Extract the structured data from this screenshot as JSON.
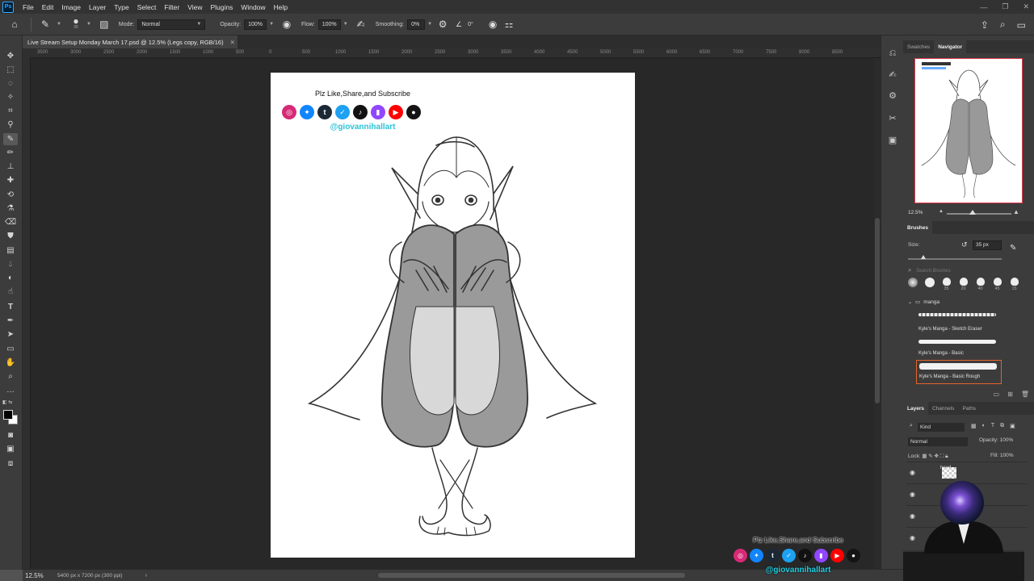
{
  "app": {
    "logo": "Ps"
  },
  "menu": [
    "File",
    "Edit",
    "Image",
    "Layer",
    "Type",
    "Select",
    "Filter",
    "View",
    "Plugins",
    "Window",
    "Help"
  ],
  "options": {
    "brush_size": "35",
    "mode_label": "Mode:",
    "mode_value": "Normal",
    "opacity_label": "Opacity:",
    "opacity_value": "100%",
    "flow_label": "Flow:",
    "flow_value": "100%",
    "smoothing_label": "Smoothing:",
    "smoothing_value": "0%",
    "angle_value": "0°"
  },
  "document": {
    "tab_title": "Live Stream Setup Monday March 17.psd @ 12.5% (Legs copy, RGB/16)",
    "zoom": "12.5%",
    "info": "5400 px x 7200 px (300 ppi)"
  },
  "ruler_ticks": [
    "3500",
    "3000",
    "2500",
    "2000",
    "1500",
    "1000",
    "500",
    "0",
    "500",
    "1000",
    "1500",
    "2000",
    "2500",
    "3000",
    "3500",
    "4000",
    "4500",
    "5000",
    "5500",
    "6000",
    "6500",
    "7000",
    "7500",
    "8000",
    "8500"
  ],
  "artwork": {
    "promo_text": "Plz Like,Share,and Subscribe",
    "handle": "@giovannihallart",
    "socials": [
      {
        "icon": "instagram-icon",
        "glyph": "◎",
        "color": "#d62976"
      },
      {
        "icon": "bluesky-icon",
        "glyph": "✦",
        "color": "#1185fe"
      },
      {
        "icon": "tumblr-icon",
        "glyph": "t",
        "color": "#1b2836"
      },
      {
        "icon": "twitter-icon",
        "glyph": "✓",
        "color": "#1da1f2"
      },
      {
        "icon": "tiktok-icon",
        "glyph": "♪",
        "color": "#111111"
      },
      {
        "icon": "twitch-icon",
        "glyph": "▮",
        "color": "#9146ff"
      },
      {
        "icon": "youtube-icon",
        "glyph": "▶",
        "color": "#ff0000"
      },
      {
        "icon": "patreon-icon",
        "glyph": "●",
        "color": "#141414"
      }
    ]
  },
  "panels": {
    "top_tabs": [
      "Swatches",
      "Navigator"
    ],
    "nav_zoom": "12.5%",
    "brushes_title": "Brushes",
    "size_label": "Size:",
    "size_value": "35 px",
    "search_placeholder": "Search Brushes",
    "tip_sizes": [
      "",
      "",
      "35",
      "20",
      "40",
      "45",
      "15"
    ],
    "folder": "manga",
    "brushes": [
      "Kyle's Manga - Sketch Eraser",
      "Kyle's Manga - Basic",
      "Kyle's Manga - Basic Rough"
    ],
    "layer_tabs": [
      "Layers",
      "Channels",
      "Paths"
    ],
    "kind": "Kind",
    "blend": "Normal",
    "opacity_label": "Opacity:",
    "opacity_value": "100%",
    "lock_label": "Lock:",
    "fill_label": "Fill:",
    "fill_value": "100%",
    "layers": [
      "head",
      "",
      "",
      ""
    ]
  },
  "overlay": {
    "promo_text": "Plz Like,Share,and Subscribe",
    "handle": "@giovannihallart"
  }
}
